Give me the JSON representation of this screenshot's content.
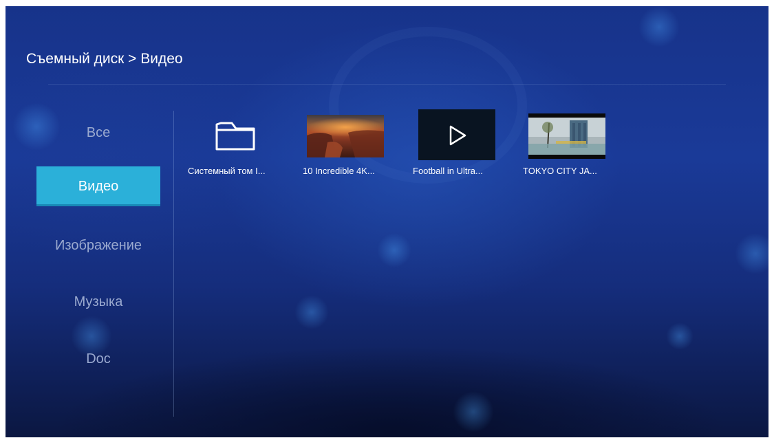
{
  "breadcrumb": "Съемный диск > Видео",
  "sidebar": {
    "items": [
      {
        "label": "Все",
        "active": false
      },
      {
        "label": "Видео",
        "active": true
      },
      {
        "label": "Изображение",
        "active": false
      },
      {
        "label": "Музыка",
        "active": false
      },
      {
        "label": "Doc",
        "active": false
      }
    ]
  },
  "files": [
    {
      "label": "Системный том I...",
      "thumbnail": "folder-icon"
    },
    {
      "label": "10 Incredible 4K...",
      "thumbnail": "canyon-video-thumbnail"
    },
    {
      "label": "Football in Ultra...",
      "thumbnail": "play-icon"
    },
    {
      "label": "TOKYO CITY JA...",
      "thumbnail": "tokyo-video-thumbnail"
    }
  ],
  "colors": {
    "accent": "#2bb0d9",
    "background": "#1a3a98",
    "inactive_text": "#9aa9cf"
  }
}
